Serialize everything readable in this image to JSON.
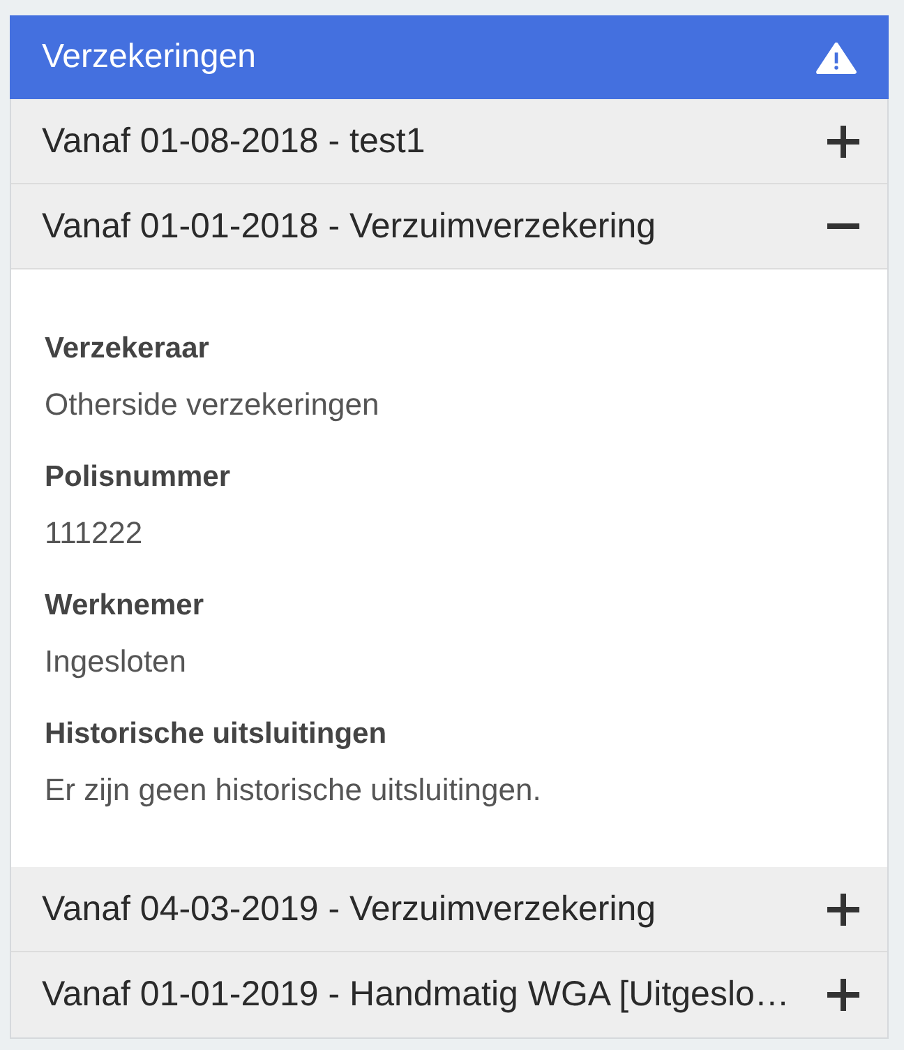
{
  "panel": {
    "title": "Verzekeringen"
  },
  "policies": [
    {
      "title": "Vanaf 01-08-2018 - test1",
      "expanded": false
    },
    {
      "title": "Vanaf 01-01-2018 - Verzuimverzekering",
      "expanded": true,
      "details": [
        {
          "label": "Verzekeraar",
          "value": "Otherside verzekeringen"
        },
        {
          "label": "Polisnummer",
          "value": "111222"
        },
        {
          "label": "Werknemer",
          "value": "Ingesloten"
        },
        {
          "label": "Historische uitsluitingen",
          "value": "Er zijn geen historische uitsluitingen."
        }
      ]
    },
    {
      "title": "Vanaf 04-03-2019 - Verzuimverzekering",
      "expanded": false
    },
    {
      "title": "Vanaf 01-01-2019 - Handmatig WGA [Uitgeslo…",
      "expanded": false
    }
  ]
}
